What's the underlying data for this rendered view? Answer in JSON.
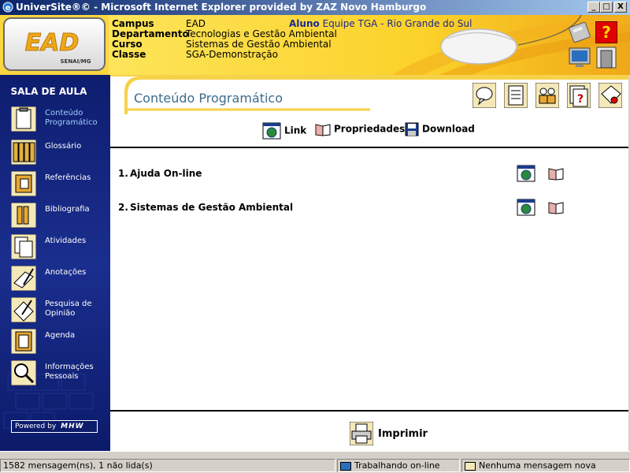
{
  "window": {
    "title": "UniverSite®© - Microsoft Internet Explorer provided by ZAZ Novo Hamburgo",
    "controls": {
      "minimize": "_",
      "maximize": "□",
      "close": "X"
    }
  },
  "header": {
    "logo_text": "EAD",
    "logo_sub": "SENAI/MG",
    "campus": {
      "label": "Campus",
      "value": "EAD"
    },
    "departamento": {
      "label": "Departamento",
      "value": "Tecnologias e Gestão Ambiental"
    },
    "curso": {
      "label": "Curso",
      "value": "Sistemas de Gestão Ambiental"
    },
    "classe": {
      "label": "Classe",
      "value": "SGA-Demonstração"
    },
    "aluno": {
      "label": "Aluno",
      "value": "Equipe TGA - Rio Grande do Sul"
    },
    "buttons": {
      "help_glyph": "?"
    }
  },
  "sidebar": {
    "title": "SALA DE AULA",
    "items": [
      {
        "label": "Conteúdo Programático",
        "icon": "clipboard-icon"
      },
      {
        "label": "Glossário",
        "icon": "binders-icon"
      },
      {
        "label": "Referências",
        "icon": "folder-icon"
      },
      {
        "label": "Bibliografia",
        "icon": "books-icon"
      },
      {
        "label": "Atividades",
        "icon": "documents-icon"
      },
      {
        "label": "Anotações",
        "icon": "notepad-icon"
      },
      {
        "label": "Pesquisa de Opinião",
        "icon": "survey-icon"
      },
      {
        "label": "Agenda",
        "icon": "agenda-icon"
      },
      {
        "label": "Informações Pessoais",
        "icon": "magnifier-icon"
      }
    ],
    "powered_by": "Powered by",
    "powered_brand": "MHW"
  },
  "content": {
    "title": "Conteúdo Programático",
    "actions": {
      "link": "Link",
      "propriedades": "Propriedades",
      "download": "Download"
    },
    "rows": [
      {
        "num": "1.",
        "label": "Ajuda On-line"
      },
      {
        "num": "2.",
        "label": "Sistemas de Gestão Ambiental"
      }
    ],
    "print": "Imprimir"
  },
  "statusbar": {
    "messages": "1582 mensagem(ns), 1 não lida(s)",
    "online": "Trabalhando on-line",
    "new_messages": "Nenhuma mensagem nova"
  }
}
